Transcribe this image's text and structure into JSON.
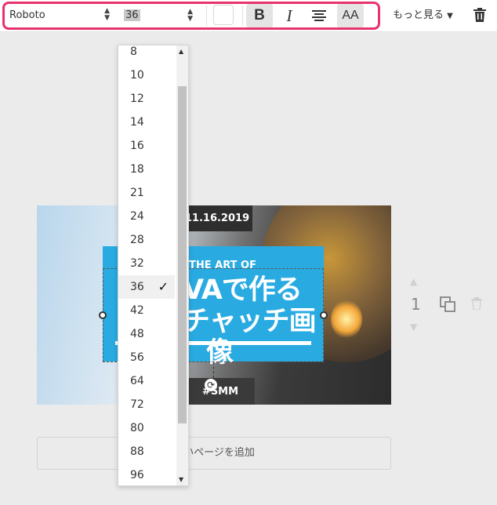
{
  "toolbar": {
    "font_family": "Roboto",
    "font_size": "36",
    "bold_label": "B",
    "italic_label": "I",
    "case_label": "AA",
    "more_label": "もっと見る",
    "highlight_color": "#e8336d"
  },
  "size_dropdown": {
    "items": [
      "8",
      "10",
      "12",
      "14",
      "16",
      "18",
      "21",
      "24",
      "28",
      "32",
      "36",
      "42",
      "48",
      "56",
      "64",
      "72",
      "80",
      "88",
      "96"
    ],
    "selected": "36"
  },
  "canvas": {
    "date_text": "11.16.2019",
    "subtitle": "THE ART OF",
    "title_line1": "VAで作る",
    "title_line2": "チャッチ画",
    "title_line3": "像",
    "hashtag": "#SMM",
    "blue_color": "#29abe2"
  },
  "page_controls": {
    "page_number": "1"
  },
  "add_page_label": "しいページを追加"
}
